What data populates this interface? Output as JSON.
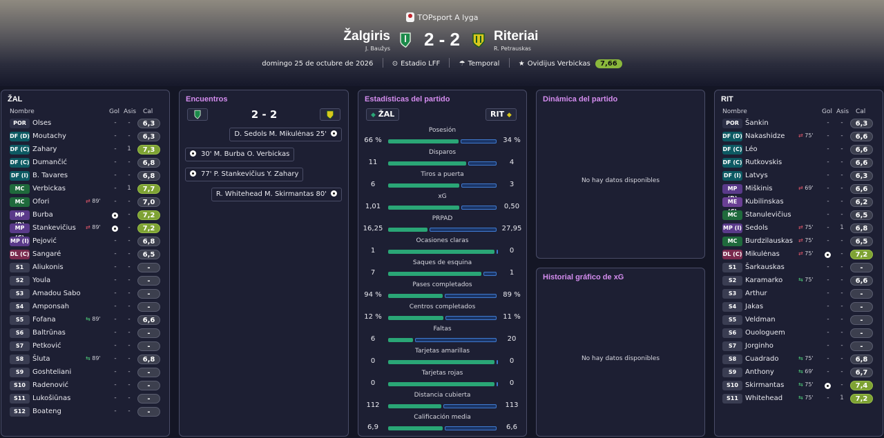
{
  "league": "TOPsport A lyga",
  "match": {
    "home_team": "Žalgiris",
    "home_coach": "J. Baužys",
    "away_team": "Riteriai",
    "away_coach": "R. Petrauskas",
    "score": "2 - 2",
    "date": "domingo 25 de octubre de 2026",
    "stadium": "Estadio LFF",
    "weather": "Temporal",
    "motm_name": "Ovidijus Verbickas",
    "motm_rating": "7,66"
  },
  "colors": {
    "accent_purple": "#d58df0",
    "rating_good": "#7ea234",
    "home_bar": "#2aa676",
    "away_bar": "#3f7ad0"
  },
  "home_panel": {
    "title": "ŽAL",
    "col_name": "Nombre",
    "col_goals": "Gol",
    "col_assists": "Asis",
    "col_rating": "Cal",
    "players": [
      {
        "pos": "POR",
        "name": "Olses",
        "event": "",
        "goals": "-",
        "assists": "-",
        "rating": "6,3"
      },
      {
        "pos": "DF (D)",
        "name": "Moutachy",
        "event": "",
        "goals": "-",
        "assists": "-",
        "rating": "6,3"
      },
      {
        "pos": "DF (C)",
        "name": "Zahary",
        "event": "",
        "goals": "-",
        "assists": "1",
        "rating": "7,3"
      },
      {
        "pos": "DF (C)",
        "name": "Dumančić",
        "event": "",
        "goals": "-",
        "assists": "-",
        "rating": "6,8"
      },
      {
        "pos": "DF (I)",
        "name": "B. Tavares",
        "event": "",
        "goals": "-",
        "assists": "-",
        "rating": "6,8"
      },
      {
        "pos": "MC",
        "name": "Verbickas",
        "event": "",
        "goals": "-",
        "assists": "1",
        "rating": "7,7"
      },
      {
        "pos": "MC",
        "name": "Ofori",
        "event": "89'",
        "goals": "-",
        "assists": "-",
        "rating": "7,0"
      },
      {
        "pos": "MP (D)",
        "name": "Burba",
        "event": "",
        "goals": "",
        "assists": "-",
        "rating": "7,2"
      },
      {
        "pos": "MP (C)",
        "name": "Stankevičius",
        "event": "89'",
        "goals": "",
        "assists": "-",
        "rating": "7,2"
      },
      {
        "pos": "MP (I)",
        "name": "Pejović",
        "event": "",
        "goals": "-",
        "assists": "-",
        "rating": "6,8"
      },
      {
        "pos": "DL (C)",
        "name": "Sangaré",
        "event": "",
        "goals": "-",
        "assists": "-",
        "rating": "6,5"
      },
      {
        "pos": "S1",
        "name": "Aliukonis",
        "event": "",
        "goals": "-",
        "assists": "-",
        "rating": "-"
      },
      {
        "pos": "S2",
        "name": "Youla",
        "event": "",
        "goals": "-",
        "assists": "-",
        "rating": "-"
      },
      {
        "pos": "S3",
        "name": "Amadou Sabo",
        "event": "",
        "goals": "-",
        "assists": "-",
        "rating": "-"
      },
      {
        "pos": "S4",
        "name": "Amponsah",
        "event": "",
        "goals": "-",
        "assists": "-",
        "rating": "-"
      },
      {
        "pos": "S5",
        "name": "Fofana",
        "event": "89'",
        "goals": "-",
        "assists": "-",
        "rating": "6,6"
      },
      {
        "pos": "S6",
        "name": "Baltrūnas",
        "event": "",
        "goals": "-",
        "assists": "-",
        "rating": "-"
      },
      {
        "pos": "S7",
        "name": "Petković",
        "event": "",
        "goals": "-",
        "assists": "-",
        "rating": "-"
      },
      {
        "pos": "S8",
        "name": "Šluta",
        "event": "89'",
        "goals": "-",
        "assists": "-",
        "rating": "6,8"
      },
      {
        "pos": "S9",
        "name": "Goshteliani",
        "event": "",
        "goals": "-",
        "assists": "-",
        "rating": "-"
      },
      {
        "pos": "S10",
        "name": "Radenović",
        "event": "",
        "goals": "-",
        "assists": "-",
        "rating": "-"
      },
      {
        "pos": "S11",
        "name": "Lukošiūnas",
        "event": "",
        "goals": "-",
        "assists": "-",
        "rating": "-"
      },
      {
        "pos": "S12",
        "name": "Boateng",
        "event": "",
        "goals": "-",
        "assists": "-",
        "rating": "-"
      }
    ]
  },
  "away_panel": {
    "title": "RIT",
    "col_name": "Nombre",
    "col_goals": "Gol",
    "col_assists": "Asis",
    "col_rating": "Cal",
    "players": [
      {
        "pos": "POR",
        "name": "Šankin",
        "event": "",
        "goals": "-",
        "assists": "-",
        "rating": "6,3"
      },
      {
        "pos": "DF (D)",
        "name": "Nakashidze",
        "event": "75'",
        "goals": "-",
        "assists": "-",
        "rating": "6,6"
      },
      {
        "pos": "DF (C)",
        "name": "Léo",
        "event": "",
        "goals": "-",
        "assists": "-",
        "rating": "6,6"
      },
      {
        "pos": "DF (C)",
        "name": "Rutkovskis",
        "event": "",
        "goals": "-",
        "assists": "-",
        "rating": "6,6"
      },
      {
        "pos": "DF (I)",
        "name": "Latvys",
        "event": "",
        "goals": "-",
        "assists": "-",
        "rating": "6,3"
      },
      {
        "pos": "MP (D)",
        "name": "Miškinis",
        "event": "69'",
        "goals": "-",
        "assists": "-",
        "rating": "6,6"
      },
      {
        "pos": "ME (C)",
        "name": "Kubilinskas",
        "event": "",
        "goals": "-",
        "assists": "-",
        "rating": "6,2"
      },
      {
        "pos": "MC",
        "name": "Stanulevičius",
        "event": "",
        "goals": "-",
        "assists": "-",
        "rating": "6,5"
      },
      {
        "pos": "MP (I)",
        "name": "Sedols",
        "event": "75'",
        "goals": "-",
        "assists": "1",
        "rating": "6,8"
      },
      {
        "pos": "MC",
        "name": "Burdzilauskas",
        "event": "75'",
        "goals": "-",
        "assists": "-",
        "rating": "6,5"
      },
      {
        "pos": "DL (C)",
        "name": "Mikulėnas",
        "event": "75'",
        "goals": "",
        "assists": "-",
        "rating": "7,2"
      },
      {
        "pos": "S1",
        "name": "Šarkauskas",
        "event": "",
        "goals": "-",
        "assists": "-",
        "rating": "-"
      },
      {
        "pos": "S2",
        "name": "Karamarko",
        "event": "75'",
        "goals": "-",
        "assists": "-",
        "rating": "6,6"
      },
      {
        "pos": "S3",
        "name": "Arthur",
        "event": "",
        "goals": "-",
        "assists": "-",
        "rating": "-"
      },
      {
        "pos": "S4",
        "name": "Jakas",
        "event": "",
        "goals": "-",
        "assists": "-",
        "rating": "-"
      },
      {
        "pos": "S5",
        "name": "Veldman",
        "event": "",
        "goals": "-",
        "assists": "-",
        "rating": "-"
      },
      {
        "pos": "S6",
        "name": "Ouologuem",
        "event": "",
        "goals": "-",
        "assists": "-",
        "rating": "-"
      },
      {
        "pos": "S7",
        "name": "Jorginho",
        "event": "",
        "goals": "-",
        "assists": "-",
        "rating": "-"
      },
      {
        "pos": "S8",
        "name": "Cuadrado",
        "event": "75'",
        "goals": "-",
        "assists": "-",
        "rating": "6,8"
      },
      {
        "pos": "S9",
        "name": "Anthony",
        "event": "69'",
        "goals": "-",
        "assists": "-",
        "rating": "6,7"
      },
      {
        "pos": "S10",
        "name": "Skirmantas",
        "event": "75'",
        "goals": "",
        "assists": "-",
        "rating": "7,4"
      },
      {
        "pos": "S11",
        "name": "Whitehead",
        "event": "75'",
        "goals": "-",
        "assists": "1",
        "rating": "7,2"
      }
    ]
  },
  "encounters": {
    "title": "Encuentros",
    "score": "2 - 2",
    "goals": [
      {
        "side": "away",
        "text": "D. Sedols M. Mikulėnas 25'"
      },
      {
        "side": "home",
        "text": "30' M. Burba O. Verbickas"
      },
      {
        "side": "home",
        "text": "77' P. Stankevičius Y. Zahary"
      },
      {
        "side": "away",
        "text": "R. Whitehead M. Skirmantas 80'"
      }
    ]
  },
  "stats": {
    "title": "Estadísticas del partido",
    "home_abbr": "ŽAL",
    "away_abbr": "RIT",
    "rows": [
      {
        "label": "Posesión",
        "home": "66 %",
        "away": "34 %",
        "h": 66,
        "a": 34
      },
      {
        "label": "Disparos",
        "home": "11",
        "away": "4",
        "h": 11,
        "a": 4
      },
      {
        "label": "Tiros a puerta",
        "home": "6",
        "away": "3",
        "h": 6,
        "a": 3
      },
      {
        "label": "xG",
        "home": "1,01",
        "away": "0,50",
        "h": 1.01,
        "a": 0.5
      },
      {
        "label": "PRPAD",
        "home": "16,25",
        "away": "27,95",
        "h": 16.25,
        "a": 27.95
      },
      {
        "label": "Ocasiones claras",
        "home": "1",
        "away": "0",
        "h": 1,
        "a": 0
      },
      {
        "label": "Saques de esquina",
        "home": "7",
        "away": "1",
        "h": 7,
        "a": 1
      },
      {
        "label": "Pases completados",
        "home": "94 %",
        "away": "89 %",
        "h": 94,
        "a": 89
      },
      {
        "label": "Centros completados",
        "home": "12 %",
        "away": "11 %",
        "h": 12,
        "a": 11
      },
      {
        "label": "Faltas",
        "home": "6",
        "away": "20",
        "h": 6,
        "a": 20
      },
      {
        "label": "Tarjetas amarillas",
        "home": "0",
        "away": "0",
        "h": 0,
        "a": 0
      },
      {
        "label": "Tarjetas rojas",
        "home": "0",
        "away": "0",
        "h": 0,
        "a": 0
      },
      {
        "label": "Distancia cubierta",
        "home": "112",
        "away": "113",
        "h": 112,
        "a": 113
      },
      {
        "label": "Calificación media",
        "home": "6,9",
        "away": "6,6",
        "h": 6.9,
        "a": 6.6
      }
    ]
  },
  "dynamics": {
    "title": "Dinámica del partido",
    "empty": "No hay datos disponibles"
  },
  "xg_history": {
    "title": "Historial gráfico de xG",
    "empty": "No hay datos disponibles"
  }
}
